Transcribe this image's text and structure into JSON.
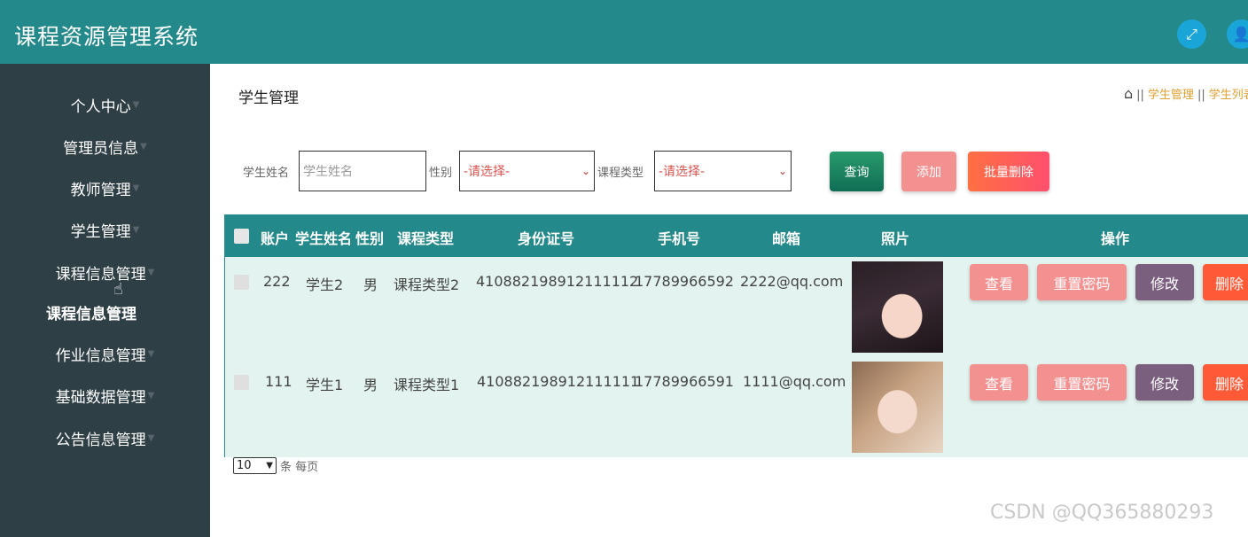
{
  "app": {
    "title": "课程资源管理系统"
  },
  "topbar": {
    "fullscreen_icon": "fullscreen-icon",
    "user_icon": "user-icon"
  },
  "sidebar": {
    "items": [
      {
        "label": "个人中心"
      },
      {
        "label": "管理员信息"
      },
      {
        "label": "教师管理"
      },
      {
        "label": "学生管理"
      },
      {
        "label": "课程信息管理"
      },
      {
        "label": "作业信息管理"
      },
      {
        "label": "基础数据管理"
      },
      {
        "label": "公告信息管理"
      }
    ],
    "sub_item": {
      "label": "课程信息管理"
    }
  },
  "page": {
    "title": "学生管理",
    "breadcrumb": [
      "学生管理",
      "学生列表"
    ]
  },
  "search": {
    "name_label": "学生姓名",
    "name_placeholder": "学生姓名",
    "gender_label": "性别",
    "gender_value": "-请选择-",
    "course_type_label": "课程类型",
    "course_type_value": "-请选择-",
    "query_label": "查询",
    "add_label": "添加",
    "batch_delete_label": "批量删除"
  },
  "table": {
    "headers": [
      "账户",
      "学生姓名",
      "性别",
      "课程类型",
      "身份证号",
      "手机号",
      "邮箱",
      "照片",
      "操作"
    ],
    "rows": [
      {
        "account": "222",
        "name": "学生2",
        "gender": "男",
        "course_type": "课程类型2",
        "id_number": "410882198912111112",
        "phone": "17789966592",
        "email": "2222@qq.com"
      },
      {
        "account": "111",
        "name": "学生1",
        "gender": "男",
        "course_type": "课程类型1",
        "id_number": "410882198912111111",
        "phone": "17789966591",
        "email": "1111@qq.com"
      }
    ],
    "actions": {
      "view": "查看",
      "reset": "重置密码",
      "edit": "修改",
      "delete": "删除"
    }
  },
  "pager": {
    "page_size": "10",
    "suffix": "条 每页"
  },
  "watermark": "CSDN @QQ365880293",
  "colors": {
    "header": "#24898a",
    "sidebar": "#2f3f46",
    "row_bg": "#e3f3ef",
    "pink": "#f29190",
    "purple": "#7b5f7f",
    "orange": "#ff5a37"
  }
}
